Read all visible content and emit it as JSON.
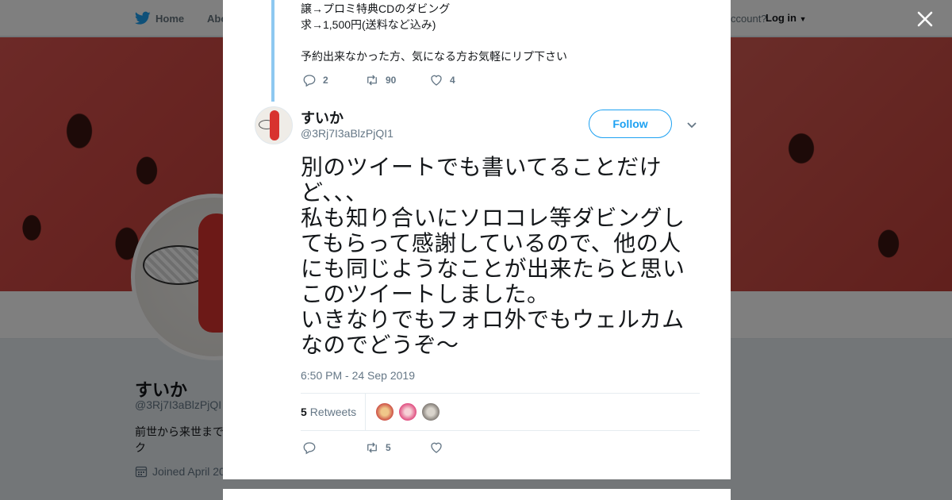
{
  "topbar": {
    "home_label": "Home",
    "about_label": "Abo",
    "account_label": "ccount?",
    "login_label": "Log in"
  },
  "profile_background": {
    "name": "すいか",
    "handle": "@3Rj7I3aBlzPjQI",
    "bio_line1": "前世から来世まで",
    "bio_line2": "ク",
    "joined": "Joined April 20"
  },
  "previous_tweet": {
    "lines": [
      "譲→プロミ特典CDのダビング",
      "求→1,500円(送料など込み)",
      "",
      "予約出来なかった方、気になる方お気軽にリプ下さい"
    ],
    "reply_count": "2",
    "retweet_count": "90",
    "like_count": "4"
  },
  "tweet": {
    "name": "すいか",
    "handle": "@3Rj7I3aBlzPjQI1",
    "follow_label": "Follow",
    "text_lines": [
      "別のツイートでも書いてることだけ",
      "ど、、、",
      "私も知り合いにソロコレ等ダビングし",
      "てもらって感謝しているので、他の人",
      "にも同じようなことが出来たらと思い",
      "このツイートしました。",
      "いきなりでもフォロ外でもウェルカム",
      "なのでどうぞ～"
    ],
    "timestamp": "6:50 PM - 24 Sep 2019",
    "retweets_count": "5",
    "retweets_label": "Retweets",
    "action_retweet_count": "5"
  },
  "colors": {
    "accent": "#1da1f2",
    "thread_line": "#8ec8f1",
    "muted_text": "#657786"
  },
  "icons": [
    "twitter-bird-icon",
    "close-icon",
    "reply-icon",
    "retweet-icon",
    "like-icon",
    "chevron-down-icon",
    "calendar-icon"
  ]
}
